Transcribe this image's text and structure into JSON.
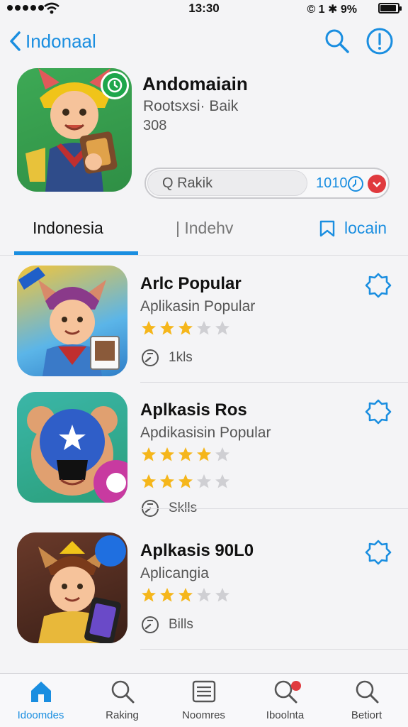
{
  "status_bar": {
    "time": "13:30",
    "right_text": "© 1 ✱ 9%"
  },
  "nav": {
    "back_label": "Indonaal"
  },
  "hero": {
    "title": "Andomaiain",
    "subtitle": "Rootsxsi· Baik",
    "size": "308",
    "search_placeholder": "Q Rakik",
    "count": "1010"
  },
  "tabs": [
    {
      "label": "Indonesia"
    },
    {
      "label": "| Indehv"
    },
    {
      "label": "locain"
    }
  ],
  "apps": [
    {
      "title": "Arlc Popular",
      "subtitle": "Aplikasin Popular",
      "rating": 3,
      "meta": "1kls",
      "has_second_stars": false
    },
    {
      "title": "Aplkasis Ros",
      "subtitle": "Apdikasisin Popular",
      "rating": 4,
      "rating2": 3,
      "meta": "Sklls",
      "has_second_stars": true
    },
    {
      "title": "Aplkasis 90L0",
      "subtitle": "Aplicangia",
      "rating": 3,
      "meta": "Bills",
      "has_second_stars": false
    }
  ],
  "tabbar": [
    {
      "label": "Idoomdes",
      "icon": "home-icon",
      "active": true
    },
    {
      "label": "Raking",
      "icon": "search-icon",
      "active": false
    },
    {
      "label": "Noomres",
      "icon": "list-icon",
      "active": false
    },
    {
      "label": "Iboolnta",
      "icon": "search-notification-icon",
      "active": false
    },
    {
      "label": "Betiort",
      "icon": "search-icon",
      "active": false
    }
  ],
  "colors": {
    "accent": "#1a8ee0",
    "star": "#f5b61b",
    "star_empty": "#cfcfd3",
    "badge_red": "#e03a3e"
  }
}
